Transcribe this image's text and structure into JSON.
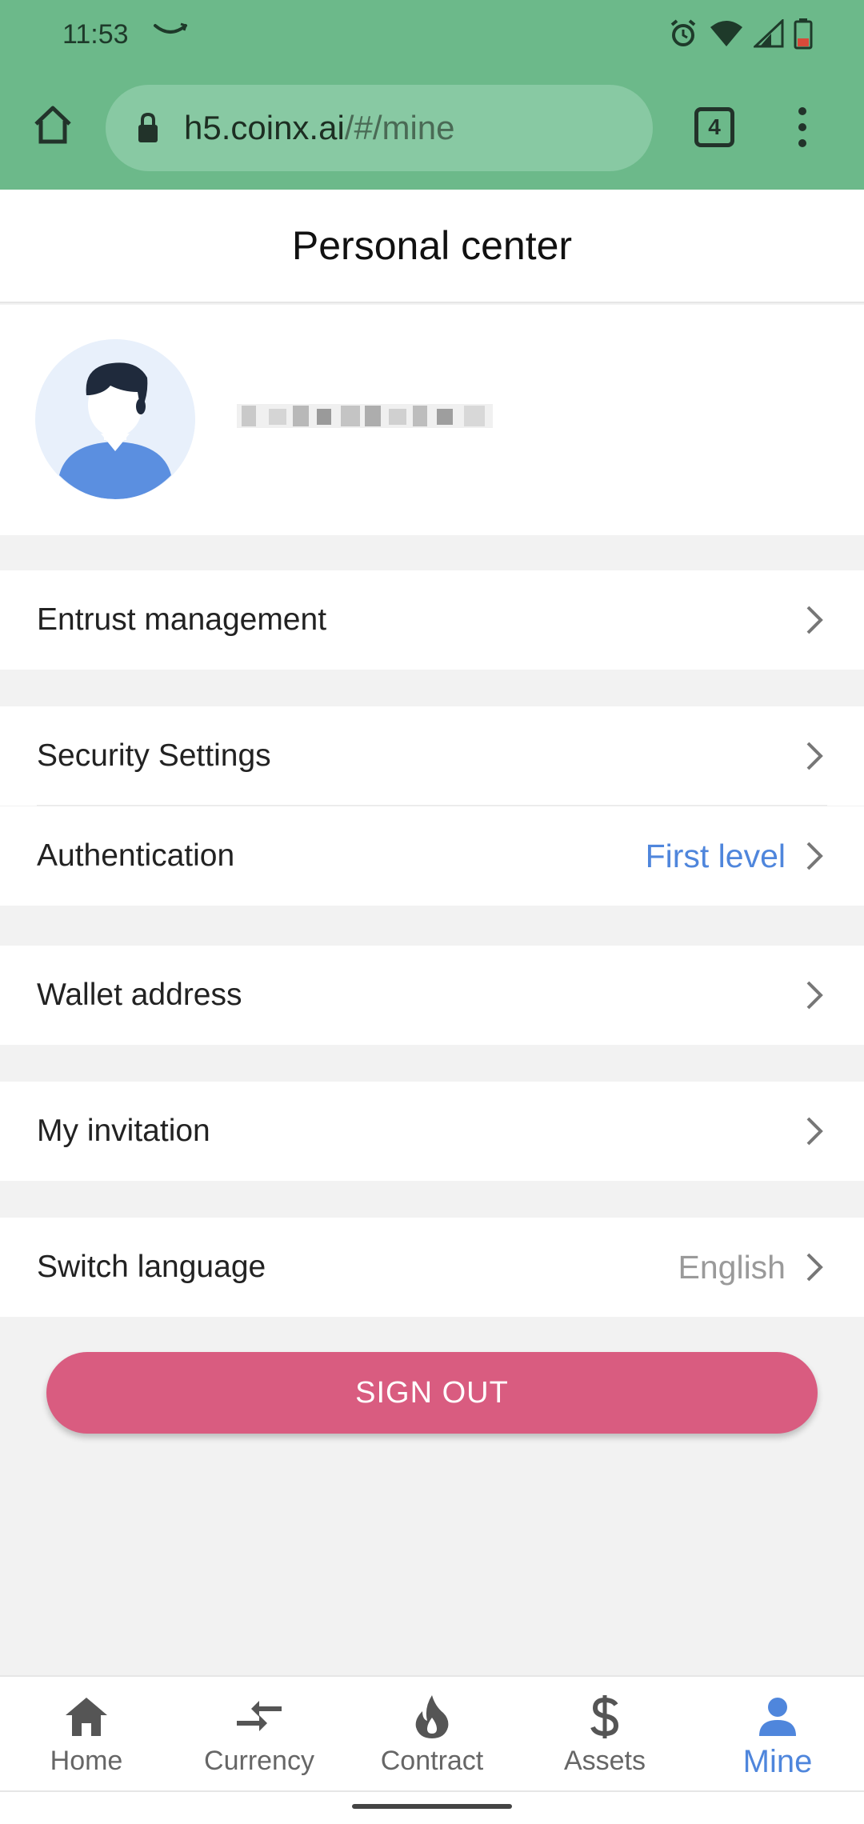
{
  "status_bar": {
    "time": "11:53"
  },
  "browser": {
    "url_host": "h5.coinx.ai",
    "url_path": "/#/mine",
    "tab_count": "4"
  },
  "header": {
    "title": "Personal center"
  },
  "menu": {
    "entrust": {
      "label": "Entrust management"
    },
    "security": {
      "label": "Security Settings"
    },
    "auth": {
      "label": "Authentication",
      "value": "First level"
    },
    "wallet": {
      "label": "Wallet address"
    },
    "invitation": {
      "label": "My invitation"
    },
    "language": {
      "label": "Switch language",
      "value": "English"
    }
  },
  "signout_label": "SIGN OUT",
  "nav": {
    "items": [
      {
        "label": "Home",
        "icon": "home-icon"
      },
      {
        "label": "Currency",
        "icon": "swap-arrows-icon"
      },
      {
        "label": "Contract",
        "icon": "flame-icon"
      },
      {
        "label": "Assets",
        "icon": "dollar-icon"
      },
      {
        "label": "Mine",
        "icon": "person-icon"
      }
    ],
    "active": "Mine"
  },
  "colors": {
    "browser_bar": "#6cb98a",
    "accent_blue": "#4f86dc",
    "signout_pink": "#d95c80"
  }
}
